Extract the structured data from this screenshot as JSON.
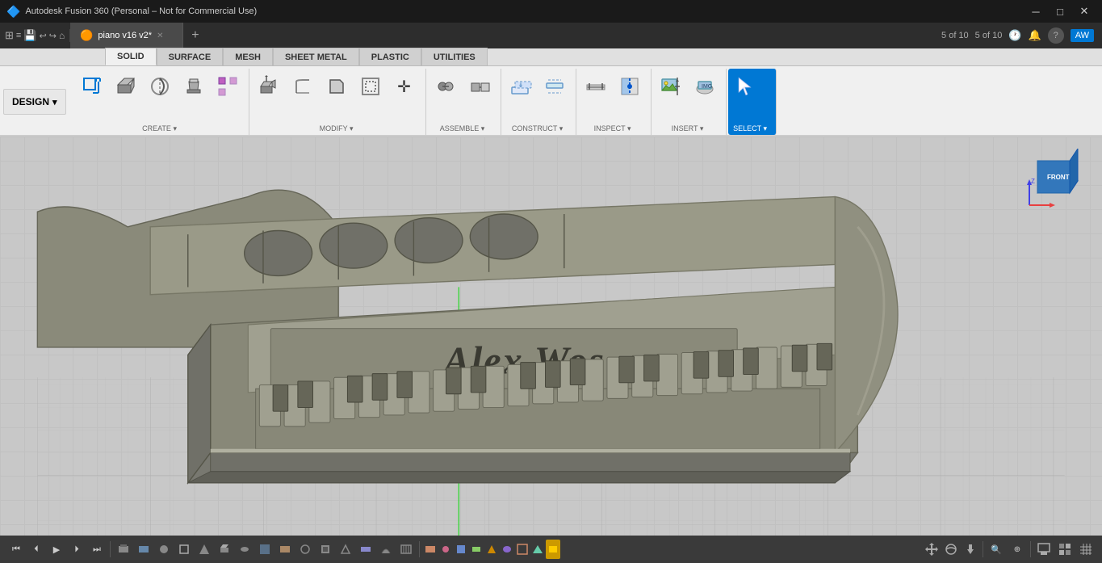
{
  "titleBar": {
    "icon": "🔷",
    "title": "Autodesk Fusion 360 (Personal – Not for Commercial Use)",
    "minimizeLabel": "─",
    "maximizeLabel": "□",
    "closeLabel": "✕"
  },
  "tabBar": {
    "tabs": [
      {
        "id": "tab1",
        "label": "piano v16 v2*",
        "active": true
      }
    ],
    "addTabLabel": "+",
    "tabCount": "5 of 10",
    "clockIcon": "🕐",
    "bellIcon": "🔔",
    "helpIcon": "?",
    "userLabel": "AW"
  },
  "ribbon": {
    "designLabel": "DESIGN",
    "designArrow": "▾",
    "tabs": [
      {
        "id": "solid",
        "label": "SOLID",
        "active": true
      },
      {
        "id": "surface",
        "label": "SURFACE"
      },
      {
        "id": "mesh",
        "label": "MESH"
      },
      {
        "id": "sheetmetal",
        "label": "SHEET METAL"
      },
      {
        "id": "plastic",
        "label": "PLASTIC"
      },
      {
        "id": "utilities",
        "label": "UTILITIES"
      }
    ],
    "groups": [
      {
        "id": "create",
        "label": "CREATE",
        "hasDropdown": true,
        "tools": [
          {
            "id": "new-component",
            "icon": "⊞",
            "label": ""
          },
          {
            "id": "extrude",
            "icon": "⬛",
            "label": ""
          },
          {
            "id": "revolve",
            "icon": "○",
            "label": ""
          },
          {
            "id": "sweep",
            "icon": "◻",
            "label": ""
          },
          {
            "id": "pattern",
            "icon": "✦",
            "label": ""
          }
        ]
      },
      {
        "id": "modify",
        "label": "MODIFY",
        "hasDropdown": true,
        "tools": [
          {
            "id": "pull",
            "icon": "◈",
            "label": ""
          },
          {
            "id": "fillet",
            "icon": "◯",
            "label": ""
          },
          {
            "id": "chamfer",
            "icon": "◻",
            "label": ""
          },
          {
            "id": "shell",
            "icon": "◫",
            "label": ""
          },
          {
            "id": "move",
            "icon": "✛",
            "label": ""
          }
        ]
      },
      {
        "id": "assemble",
        "label": "ASSEMBLE",
        "hasDropdown": true,
        "tools": [
          {
            "id": "joint",
            "icon": "⚙",
            "label": ""
          },
          {
            "id": "rigid-group",
            "icon": "▤",
            "label": ""
          }
        ]
      },
      {
        "id": "construct",
        "label": "CONSTRUCT",
        "hasDropdown": true,
        "tools": [
          {
            "id": "offset-plane",
            "icon": "▭",
            "label": ""
          },
          {
            "id": "midplane",
            "icon": "▬",
            "label": ""
          }
        ]
      },
      {
        "id": "inspect",
        "label": "INSPECT",
        "hasDropdown": true,
        "tools": [
          {
            "id": "measure",
            "icon": "📏",
            "label": ""
          },
          {
            "id": "section",
            "icon": "🔍",
            "label": ""
          }
        ]
      },
      {
        "id": "insert",
        "label": "INSERT",
        "hasDropdown": true,
        "tools": [
          {
            "id": "insert-image",
            "icon": "🖼",
            "label": ""
          },
          {
            "id": "decal",
            "icon": "🏷",
            "label": ""
          }
        ]
      },
      {
        "id": "select",
        "label": "SELECT",
        "hasDropdown": true,
        "active": true,
        "tools": [
          {
            "id": "select-tool",
            "icon": "↖",
            "label": ""
          }
        ]
      }
    ]
  },
  "viewport": {
    "backgroundColor": "#cccccc",
    "gridColor": "#bbbbbb",
    "pianoText": "Alex Wos"
  },
  "navCube": {
    "frontLabel": "FRONT",
    "colors": {
      "x": "#e84040",
      "y": "#40c040",
      "z": "#4040e8"
    }
  },
  "bottomToolbar": {
    "tools": [
      "⊕",
      "⊞",
      "🖐",
      "🔍",
      "⊖",
      "⊕",
      "□",
      "⊡",
      "▦"
    ]
  },
  "statusBar": {
    "playLabel": "▶",
    "icons": [
      "⏮",
      "⏴",
      "▶",
      "⏵",
      "⏭"
    ]
  }
}
